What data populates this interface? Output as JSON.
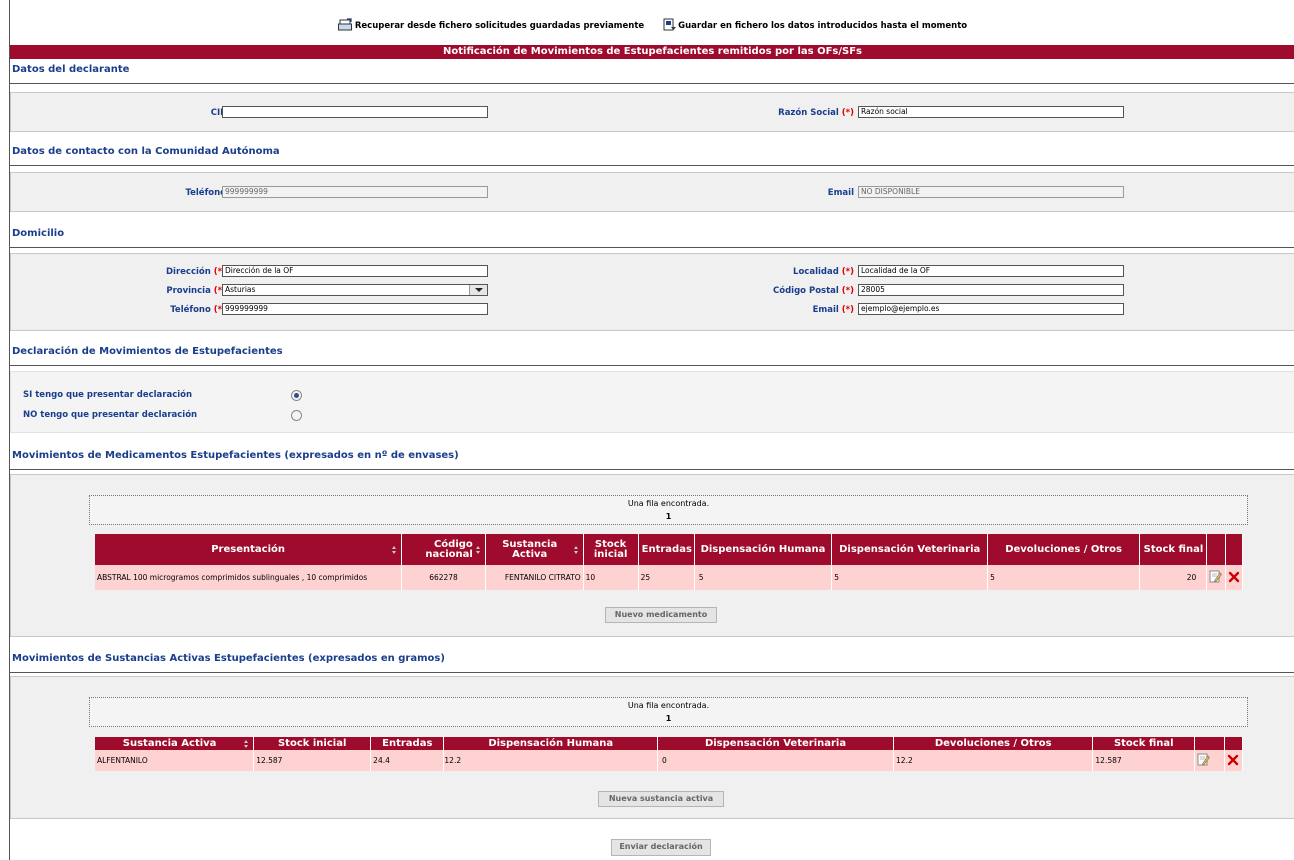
{
  "top_links": {
    "recover": "Recuperar desde fichero solicitudes guardadas previamente",
    "save": "Guardar en fichero los datos introducidos hasta el momento"
  },
  "title": "Notificación de Movimientos de Estupefacientes remitidos por las OFs/SFs",
  "declarante": {
    "section_title": "Datos del declarante",
    "cif_label": "CIF",
    "cif_value": "",
    "razon_label": "Razón Social",
    "razon_value": "Razón social"
  },
  "contacto": {
    "section_title": "Datos de contacto con la Comunidad Autónoma",
    "telefono_label": "Teléfono",
    "telefono_value": "999999999",
    "email_label": "Email",
    "email_value": "NO DISPONIBLE"
  },
  "domicilio": {
    "section_title": "Domicilio",
    "direccion_label": "Dirección",
    "direccion_value": "Dirección de la OF",
    "provincia_label": "Provincia",
    "provincia_value": "Asturias",
    "telefono_label": "Teléfono",
    "telefono_value": "999999999",
    "localidad_label": "Localidad",
    "localidad_value": "Localidad de la OF",
    "cp_label": "Código Postal",
    "cp_value": "28005",
    "email_label": "Email",
    "email_value": "ejemplo@ejemplo.es",
    "required_mark": "(*)"
  },
  "declaracion": {
    "section_title": "Declaración de Movimientos de Estupefacientes",
    "si_label": "SI tengo que presentar declaración",
    "no_label": "NO tengo que presentar declaración",
    "selected": "si"
  },
  "medicamentos": {
    "section_title": "Movimientos de Medicamentos Estupefacientes (expresados en nº de envases)",
    "found_text": "Una fila encontrada.",
    "page": "1",
    "columns": [
      "Presentación",
      "Código nacional",
      "Sustancia Activa",
      "Stock inicial",
      "Entradas",
      "Dispensación Humana",
      "Dispensación Veterinaria",
      "Devoluciones / Otros",
      "Stock final"
    ],
    "rows": [
      [
        "ABSTRAL 100 microgramos comprimidos sublinguales , 10 comprimidos",
        "662278",
        "FENTANILO CITRATO",
        "10",
        "25",
        "5",
        "5",
        "5",
        "20"
      ]
    ],
    "button": "Nuevo medicamento"
  },
  "sustancias": {
    "section_title": "Movimientos de Sustancias Activas Estupefacientes (expresados en gramos)",
    "found_text": "Una fila encontrada.",
    "page": "1",
    "columns": [
      "Sustancia Activa",
      "Stock inicial",
      "Entradas",
      "Dispensación Humana",
      "Dispensación Veterinaria",
      "Devoluciones / Otros",
      "Stock final"
    ],
    "rows": [
      [
        "ALFENTANILO",
        "12.587",
        "24.4",
        "12.2",
        "0",
        "12.2",
        "12.587"
      ]
    ],
    "button": "Nueva sustancia activa"
  },
  "submit_button": "Enviar declaración",
  "colors": {
    "brand": "#9e0b2c",
    "section_title": "#1a3e8c",
    "row_bg": "#ffd2d2",
    "required": "#dd0000"
  }
}
